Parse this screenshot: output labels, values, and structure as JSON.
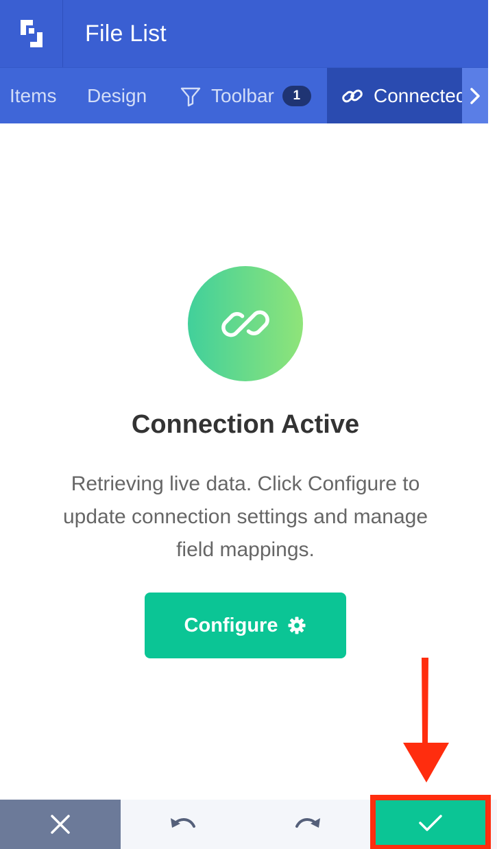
{
  "header": {
    "logo_icon": "bracket-logo-icon",
    "title": "File List"
  },
  "tabs": [
    {
      "label": "Items",
      "icon": null,
      "active": false
    },
    {
      "label": "Design",
      "icon": null,
      "active": false
    },
    {
      "label": "Toolbar",
      "icon": "filter-icon",
      "badge": "1",
      "active": false
    },
    {
      "label": "Connected",
      "icon": "link-icon",
      "active": true
    }
  ],
  "tab_scroll_icon": "chevron-right-icon",
  "status": {
    "icon": "link-icon",
    "title": "Connection Active",
    "description": "Retrieving live data. Click Configure to update connection settings and manage field mappings."
  },
  "configure_button": {
    "label": "Configure",
    "icon": "gear-icon"
  },
  "bottom_bar": {
    "cancel_icon": "close-icon",
    "undo_icon": "undo-icon",
    "redo_icon": "redo-icon",
    "confirm_icon": "check-icon"
  },
  "colors": {
    "header_bg": "#3a5fd2",
    "tabbar_bg": "#3f66d8",
    "active_tab_bg": "#2a4bb0",
    "accent_green": "#0bc595",
    "annotation_red": "#ff2d0e",
    "cancel_bg": "#6c7a99"
  }
}
